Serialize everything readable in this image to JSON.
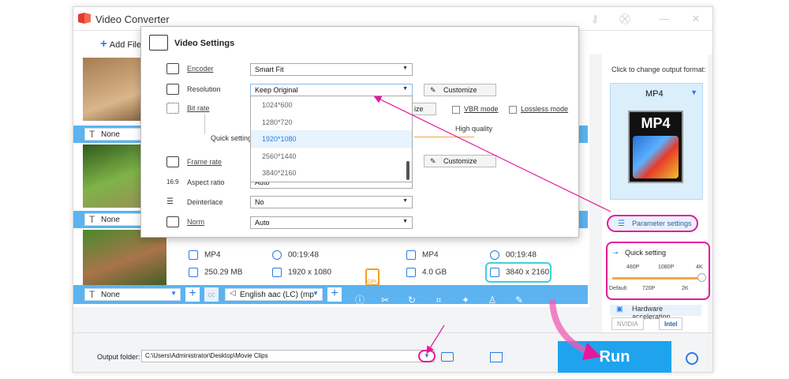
{
  "app": {
    "title": "Video Converter"
  },
  "toolbar": {
    "add_files": "Add Files"
  },
  "rows": [
    {
      "subtitle": "None"
    },
    {
      "subtitle": "None"
    },
    {
      "subtitle": "None",
      "audio": "English aac (LC) (mp",
      "source": {
        "format": "MP4",
        "duration": "00:19:48",
        "size": "250.29 MB",
        "resolution": "1920 x 1080"
      },
      "output": {
        "format": "MP4",
        "duration": "00:19:48",
        "size": "4.0 GB",
        "resolution": "3840 x 2160"
      }
    }
  ],
  "gpu_label": "GPU",
  "right_panel": {
    "title": "Click to change output format:",
    "format": "MP4",
    "format_icon_label": "MP4",
    "parameter_settings": "Parameter settings",
    "quick_setting": {
      "title": "Quick setting",
      "top_labels": [
        "480P",
        "1080P",
        "4K"
      ],
      "bottom_labels": [
        "Default",
        "720P",
        "2K"
      ],
      "level": 1.0
    },
    "hardware_accel": "Hardware acceleration",
    "chips": [
      "NVIDIA",
      "Intel"
    ]
  },
  "bottom": {
    "output_folder_label": "Output folder:",
    "output_folder_path": "C:\\Users\\Administrator\\Desktop\\Movie Clips",
    "run": "Run"
  },
  "dialog": {
    "title": "Video Settings",
    "fields": {
      "encoder": {
        "label": "Encoder",
        "value": "Smart Fit"
      },
      "resolution": {
        "label": "Resolution",
        "value": "Keep Original",
        "customize": "Customize"
      },
      "bitrate": {
        "label": "Bit rate",
        "customize_partial": "ize",
        "vbr": "VBR mode",
        "lossless": "Lossless mode",
        "quick_partial": "Quick setting",
        "high_quality": "High quality"
      },
      "frame_rate": {
        "label": "Frame rate",
        "customize": "Customize"
      },
      "aspect_ratio": {
        "label": "Aspect ratio",
        "value": "Auto"
      },
      "deinterlace": {
        "label": "Deinterlace",
        "value": "No"
      },
      "norm": {
        "label": "Norm",
        "value": "Auto"
      }
    },
    "resolution_options": [
      "1024*600",
      "1280*720",
      "1920*1080",
      "2560*1440",
      "3840*2160"
    ],
    "selected_option": "1920*1080"
  },
  "colors": {
    "accent": "#2a7be4",
    "highlight": "#e6179a",
    "run": "#1fa3ee",
    "row_bar": "#5cb3f0"
  }
}
